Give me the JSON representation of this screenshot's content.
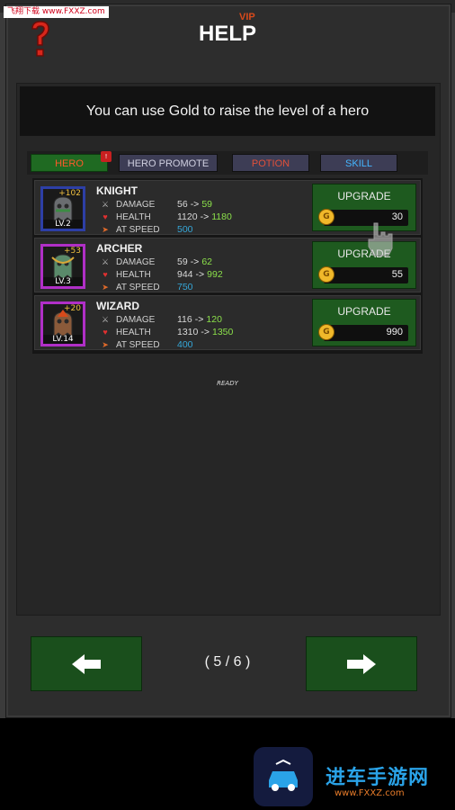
{
  "watermark_top": "飞翔下载 www.FXXZ.com",
  "header": {
    "vip_label": "VIP",
    "title": "HELP"
  },
  "info_text": "You can use Gold to raise the level of a hero",
  "tabs": [
    {
      "label": "HERO",
      "active": true,
      "badge": "!"
    },
    {
      "label": "HERO PROMOTE"
    },
    {
      "label": "POTION"
    },
    {
      "label": "SKILL"
    }
  ],
  "stat_labels": {
    "damage": "DAMAGE",
    "health": "HEALTH",
    "speed": "AT SPEED"
  },
  "arrow": "->",
  "heroes": [
    {
      "name": "KNIGHT",
      "level": "LV.2",
      "bonus": "+102",
      "damage_from": "56",
      "damage_to": "59",
      "health_from": "1120",
      "health_to": "1180",
      "speed": "500",
      "upgrade_label": "UPGRADE",
      "cost": "30"
    },
    {
      "name": "ARCHER",
      "level": "LV.3",
      "bonus": "+53",
      "damage_from": "59",
      "damage_to": "62",
      "health_from": "944",
      "health_to": "992",
      "speed": "750",
      "upgrade_label": "UPGRADE",
      "cost": "55"
    },
    {
      "name": "WIZARD",
      "level": "LV.14",
      "bonus": "+20",
      "damage_from": "116",
      "damage_to": "120",
      "health_from": "1310",
      "health_to": "1350",
      "speed": "400",
      "upgrade_label": "UPGRADE",
      "cost": "990"
    }
  ],
  "ready_text": "READY",
  "pager": {
    "indicator": "( 5 / 6 )"
  },
  "watermark_bottom": {
    "text": "进车手游网",
    "url": "www.FXXZ.com"
  },
  "colors": {
    "button_green": "#1e5a1f",
    "accent_red": "#d84a1b",
    "speed_blue": "#35a7d8",
    "value_green": "#8be04a"
  }
}
